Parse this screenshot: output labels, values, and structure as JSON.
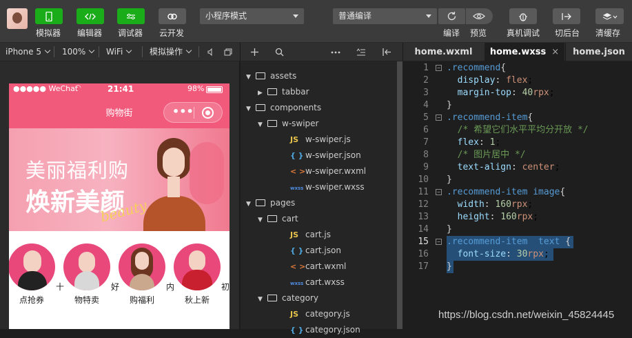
{
  "toolbar": {
    "buttons": [
      {
        "label": "模拟器",
        "icon": "phone-icon"
      },
      {
        "label": "编辑器",
        "icon": "code-icon"
      },
      {
        "label": "调试器",
        "icon": "debug-toggle-icon"
      },
      {
        "label": "云开发",
        "icon": "cloud-link-icon"
      }
    ],
    "mode_select": "小程序模式",
    "compile_select": "普通编译",
    "right_buttons": [
      {
        "label": "编译",
        "icon": "refresh-icon"
      },
      {
        "label": "预览",
        "icon": "eye-icon"
      },
      {
        "label": "真机调试",
        "icon": "bug-icon"
      },
      {
        "label": "切后台",
        "icon": "switch-icon"
      },
      {
        "label": "清缓存",
        "icon": "layers-icon"
      }
    ],
    "colors": {
      "green": "#1aad19",
      "bar": "#3b3b3b"
    }
  },
  "subbar": {
    "device": "iPhone 5",
    "zoom": "100%",
    "network": "WiFi",
    "simulate": "模拟操作"
  },
  "tabs": [
    {
      "label": "home.wxml",
      "active": false
    },
    {
      "label": "home.wxss",
      "active": true,
      "close": "×"
    },
    {
      "label": "home.json",
      "active": false
    }
  ],
  "phone": {
    "carrier": "●●●●● WeChat",
    "time": "21:41",
    "battery": "98%",
    "title": "购物街",
    "capsule_dots": "•••",
    "banner_line1": "美丽福利购",
    "banner_line2": "焕新美颜",
    "banner_script": "beauty",
    "recommend": [
      {
        "label": "点抢券",
        "side": "十"
      },
      {
        "label": "物特卖",
        "side": "好"
      },
      {
        "label": "购福利",
        "side": "内"
      },
      {
        "label": "秋上新",
        "side": "初"
      }
    ],
    "theme_color": "#f25a7b"
  },
  "tree": [
    {
      "type": "folder",
      "open": true,
      "name": "assets",
      "indent": 0
    },
    {
      "type": "folder",
      "open": false,
      "name": "tabbar",
      "indent": 1
    },
    {
      "type": "folder",
      "open": true,
      "name": "components",
      "indent": 0
    },
    {
      "type": "folder",
      "open": true,
      "name": "w-swiper",
      "indent": 1
    },
    {
      "type": "file",
      "kind": "JS",
      "name": "w-swiper.js",
      "indent": 2
    },
    {
      "type": "file",
      "kind": "{ }",
      "name": "w-swiper.json",
      "indent": 2
    },
    {
      "type": "file",
      "kind": "< >",
      "name": "w-swiper.wxml",
      "indent": 2
    },
    {
      "type": "file",
      "kind": "wxss",
      "name": "w-swiper.wxss",
      "indent": 2
    },
    {
      "type": "folder",
      "open": true,
      "name": "pages",
      "indent": 0
    },
    {
      "type": "folder",
      "open": true,
      "name": "cart",
      "indent": 1
    },
    {
      "type": "file",
      "kind": "JS",
      "name": "cart.js",
      "indent": 2
    },
    {
      "type": "file",
      "kind": "{ }",
      "name": "cart.json",
      "indent": 2
    },
    {
      "type": "file",
      "kind": "< >",
      "name": "cart.wxml",
      "indent": 2
    },
    {
      "type": "file",
      "kind": "wxss",
      "name": "cart.wxss",
      "indent": 2
    },
    {
      "type": "folder",
      "open": true,
      "name": "category",
      "indent": 1
    },
    {
      "type": "file",
      "kind": "JS",
      "name": "category.js",
      "indent": 2
    },
    {
      "type": "file",
      "kind": "{ }",
      "name": "category.json",
      "indent": 2
    }
  ],
  "code": [
    {
      "n": "1",
      "fold": "−",
      "text": ".recommend{"
    },
    {
      "n": "2",
      "fold": "",
      "text": "  display: flex;"
    },
    {
      "n": "3",
      "fold": "",
      "text": "  margin-top: 40rpx;"
    },
    {
      "n": "4",
      "fold": "",
      "text": "}"
    },
    {
      "n": "5",
      "fold": "−",
      "text": ".recommend-item{"
    },
    {
      "n": "6",
      "fold": "",
      "text": "  /* 希望它们水平平均分开放 */"
    },
    {
      "n": "7",
      "fold": "",
      "text": "  flex: 1;"
    },
    {
      "n": "8",
      "fold": "",
      "text": "  /* 图片居中 */"
    },
    {
      "n": "9",
      "fold": "",
      "text": "  text-align: center;"
    },
    {
      "n": "10",
      "fold": "",
      "text": "}"
    },
    {
      "n": "11",
      "fold": "−",
      "text": ".recommend-item image{"
    },
    {
      "n": "12",
      "fold": "",
      "text": "  width: 160rpx;"
    },
    {
      "n": "13",
      "fold": "",
      "text": "  height: 160rpx;"
    },
    {
      "n": "14",
      "fold": "",
      "text": "}"
    },
    {
      "n": "15",
      "fold": "−",
      "text": ".recommend-item  text {"
    },
    {
      "n": "16",
      "fold": "",
      "text": "  font-size: 30rpx;"
    },
    {
      "n": "17",
      "fold": "",
      "text": "}"
    }
  ],
  "watermark": "https://blog.csdn.net/weixin_45824445"
}
